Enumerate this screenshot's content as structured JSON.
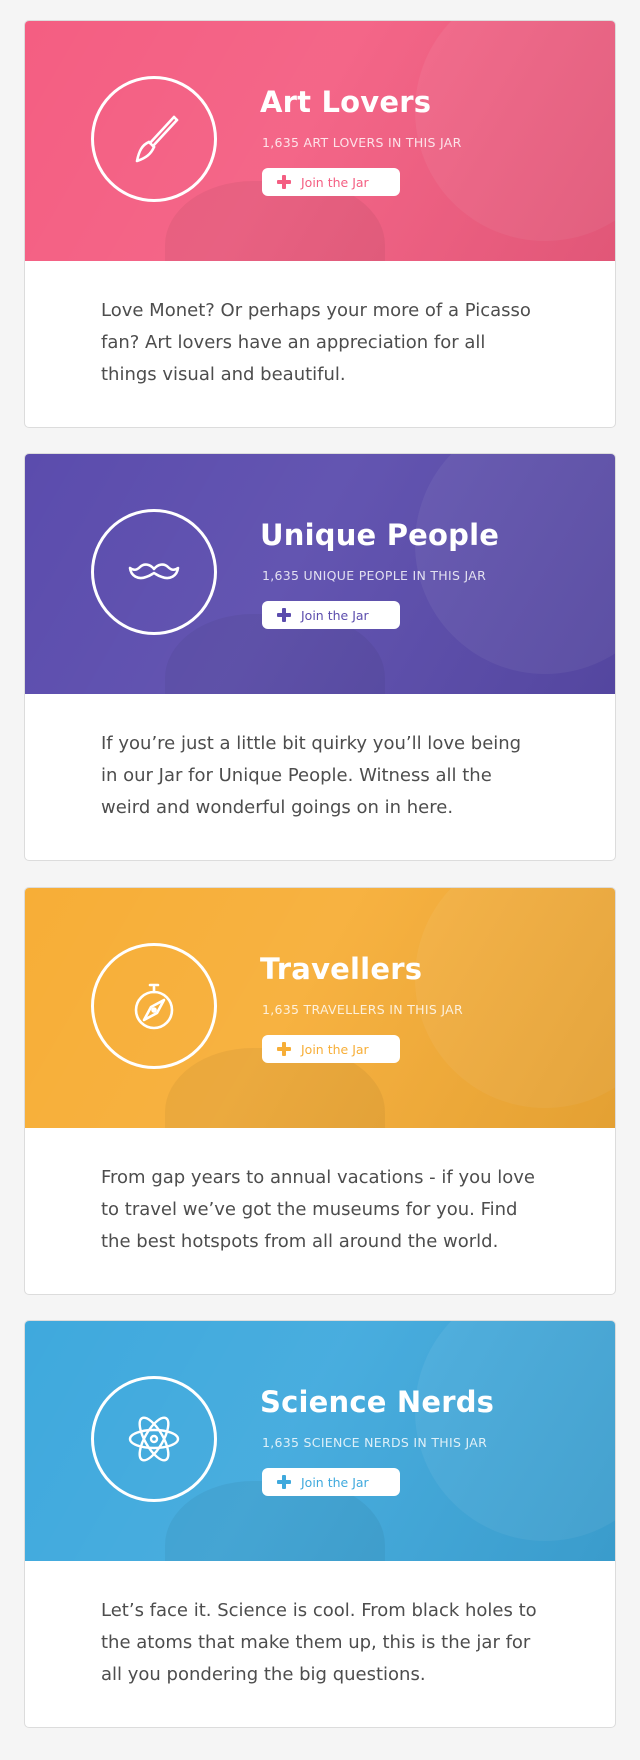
{
  "cards": [
    {
      "title": "Art Lovers",
      "count_text": "1,635 ART LOVERS IN THIS JAR",
      "button_label": "Join the Jar",
      "description": "Love Monet? Or perhaps your more of a Picasso fan? Art lovers have an appreciation for all things visual and beautiful.",
      "color": "#f45e82",
      "icon": "paintbrush-icon"
    },
    {
      "title": "Unique People",
      "count_text": "1,635 UNIQUE PEOPLE IN THIS JAR",
      "button_label": "Join the Jar",
      "description": "If you’re just a little bit quirky you’ll love being in our Jar for Unique People. Witness all the weird and wonderful goings on in here.",
      "color": "#5b4cad",
      "icon": "mustache-icon"
    },
    {
      "title": "Travellers",
      "count_text": "1,635 TRAVELLERS IN THIS JAR",
      "button_label": "Join the Jar",
      "description": "From gap years to annual vacations - if you love to travel we’ve got the museums for you. Find the best hotspots from all around the world.",
      "color": "#f7ae37",
      "icon": "compass-icon"
    },
    {
      "title": "Science Nerds",
      "count_text": "1,635 SCIENCE NERDS IN THIS JAR",
      "button_label": "Join the Jar",
      "description": "Let’s face it. Science is cool. From black holes to the atoms that make them up, this is the jar for all you pondering the big questions.",
      "color": "#3fa9dd",
      "icon": "atom-icon"
    }
  ]
}
